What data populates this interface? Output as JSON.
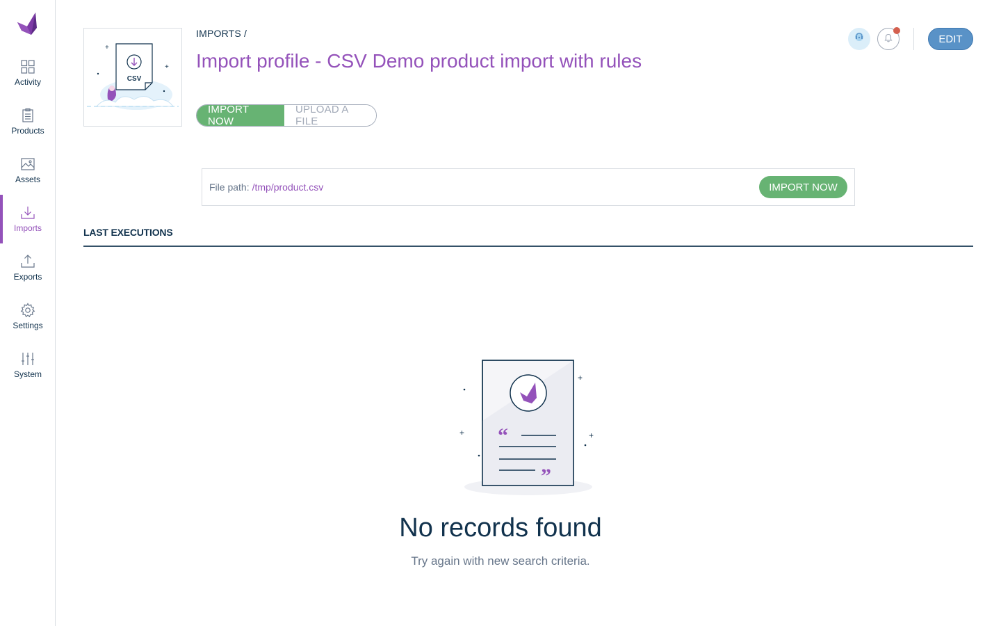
{
  "sidebar": {
    "items": [
      {
        "label": "Activity",
        "icon": "dashboard-icon"
      },
      {
        "label": "Products",
        "icon": "clipboard-icon"
      },
      {
        "label": "Assets",
        "icon": "image-icon"
      },
      {
        "label": "Imports",
        "icon": "import-icon",
        "active": true
      },
      {
        "label": "Exports",
        "icon": "export-icon"
      },
      {
        "label": "Settings",
        "icon": "gear-icon"
      },
      {
        "label": "System",
        "icon": "sliders-icon"
      }
    ]
  },
  "header": {
    "breadcrumb": "IMPORTS /",
    "title": "Import profile - CSV Demo product import with rules",
    "illustration_text": "CSV",
    "import_now_label": "IMPORT NOW",
    "upload_file_label": "UPLOAD A FILE",
    "edit_label": "EDIT"
  },
  "file_path": {
    "label": "File path:",
    "value": "/tmp/product.csv",
    "import_label": "IMPORT NOW"
  },
  "executions": {
    "title": "LAST EXECUTIONS",
    "empty_title": "No records found",
    "empty_subtitle": "Try again with new search criteria."
  },
  "colors": {
    "accent": "#9452ba",
    "success": "#67b373",
    "primary_blue": "#5992c7",
    "text": "#11324d",
    "notification": "#d4604f"
  }
}
